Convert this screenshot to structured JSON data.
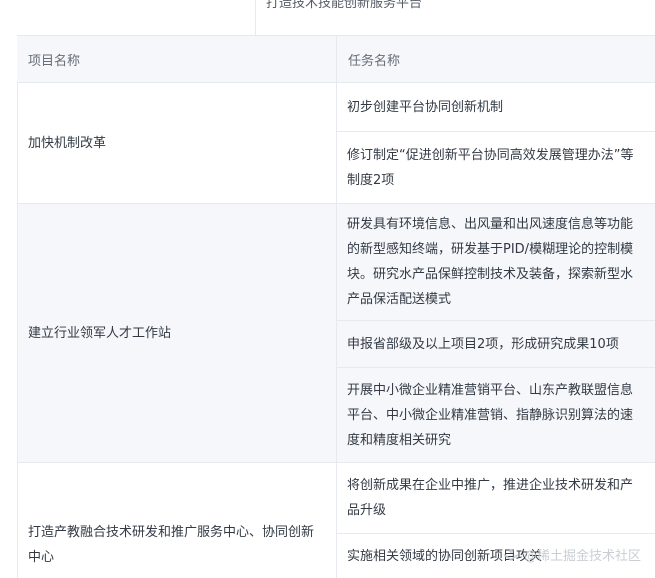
{
  "top_fragment": {
    "left_text": "-",
    "right_text": "打造技术技能创新服务平台"
  },
  "header": {
    "col1": "项目名称",
    "col2": "任务名称"
  },
  "rows": [
    {
      "project": "加快机制改革",
      "tasks": [
        "初步创建平台协同创新机制",
        "修订制定“促进创新平台协同高效发展管理办法”等制度2项"
      ]
    },
    {
      "project": "建立行业领军人才工作站",
      "tasks": [
        "研发具有环境信息、出风量和出风速度信息等功能的新型感知终端，研发基于PID/模糊理论的控制模块。研究水产品保鲜控制技术及装备，探索新型水产品保活配送模式",
        "申报省部级及以上项目2项，形成研究成果10项",
        "开展中小微企业精准营销平台、山东产教联盟信息平台、中小微企业精准营销、指静脉识别算法的速度和精度相关研究"
      ]
    },
    {
      "project": "打造产教融合技术研发和推广服务中心、协同创新中心",
      "tasks": [
        "将创新成果在企业中推广，推进企业技术研发和产品升级",
        "实施相关领域的协同创新项目攻关"
      ]
    }
  ],
  "watermark": {
    "text": "@稀土掘金技术社区",
    "icon": "juejin-logo-icon"
  }
}
